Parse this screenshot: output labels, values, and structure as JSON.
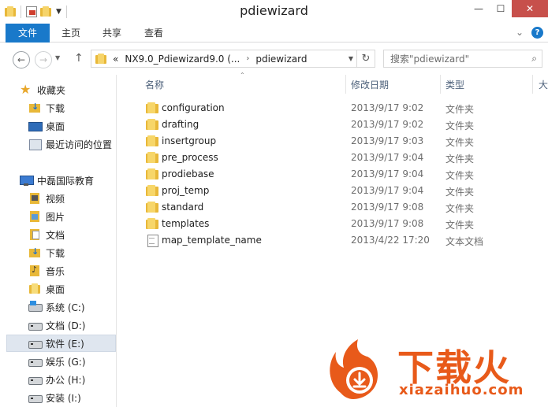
{
  "window": {
    "title": "pdiewizard"
  },
  "ribbon": {
    "tabs": [
      {
        "label": "文件",
        "active": true
      },
      {
        "label": "主页",
        "active": false
      },
      {
        "label": "共享",
        "active": false
      },
      {
        "label": "查看",
        "active": false
      }
    ]
  },
  "address": {
    "prefix": "«",
    "crumbs": [
      "NX9.0_Pdiewizard9.0 (...",
      "pdiewizard"
    ],
    "search_placeholder": "搜索\"pdiewizard\""
  },
  "nav": {
    "favorites": {
      "label": "收藏夹",
      "items": [
        "下载",
        "桌面",
        "最近访问的位置"
      ]
    },
    "computer": {
      "label": "中磊国际教育",
      "items": [
        "视频",
        "图片",
        "文档",
        "下载",
        "音乐",
        "桌面"
      ],
      "drives": [
        "系统 (C:)",
        "文档 (D:)",
        "软件 (E:)",
        "娱乐 (G:)",
        "办公 (H:)",
        "安装 (I:)"
      ],
      "selected_drive": "软件 (E:)"
    }
  },
  "columns": {
    "name": "名称",
    "date": "修改日期",
    "type": "类型",
    "size": "大"
  },
  "files": [
    {
      "name": "configuration",
      "date": "2013/9/17 9:02",
      "type": "文件夹",
      "kind": "folder"
    },
    {
      "name": "drafting",
      "date": "2013/9/17 9:02",
      "type": "文件夹",
      "kind": "folder"
    },
    {
      "name": "insertgroup",
      "date": "2013/9/17 9:03",
      "type": "文件夹",
      "kind": "folder"
    },
    {
      "name": "pre_process",
      "date": "2013/9/17 9:04",
      "type": "文件夹",
      "kind": "folder"
    },
    {
      "name": "prodiebase",
      "date": "2013/9/17 9:04",
      "type": "文件夹",
      "kind": "folder"
    },
    {
      "name": "proj_temp",
      "date": "2013/9/17 9:04",
      "type": "文件夹",
      "kind": "folder"
    },
    {
      "name": "standard",
      "date": "2013/9/17 9:08",
      "type": "文件夹",
      "kind": "folder"
    },
    {
      "name": "templates",
      "date": "2013/9/17 9:08",
      "type": "文件夹",
      "kind": "folder"
    },
    {
      "name": "map_template_name",
      "date": "2013/4/22 17:20",
      "type": "文本文档",
      "kind": "text"
    }
  ],
  "watermark": {
    "text": "下载火",
    "url": "xiazaihuo.com"
  },
  "colors": {
    "accent": "#1979ca",
    "close": "#c7504b",
    "watermark": "#e85a1a"
  }
}
